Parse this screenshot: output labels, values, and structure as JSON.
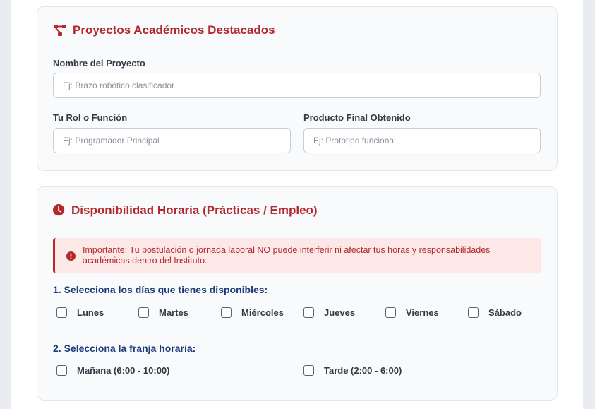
{
  "projects": {
    "title": "Proyectos Académicos Destacados",
    "icon": "project-diagram-icon",
    "name_label": "Nombre del Proyecto",
    "name_placeholder": "Ej: Brazo robótico clasificador",
    "role_label": "Tu Rol o Función",
    "role_placeholder": "Ej: Programador Principal",
    "product_label": "Producto Final Obtenido",
    "product_placeholder": "Ej: Prototipo funcional"
  },
  "availability": {
    "title": "Disponibilidad Horaria (Prácticas / Empleo)",
    "icon": "clock-icon",
    "alert_icon": "info-circle-icon",
    "alert_text": "Importante: Tu postulación o jornada laboral NO puede interferir ni afectar tus horas y responsabilidades académicas dentro del Instituto.",
    "days_question": "1. Selecciona los días que tienes disponibles:",
    "days": [
      "Lunes",
      "Martes",
      "Miércoles",
      "Jueves",
      "Viernes",
      "Sábado"
    ],
    "shift_question": "2. Selecciona la franja horaria:",
    "shifts": [
      "Mañana (6:00 - 10:00)",
      "Tarde (2:00 - 6:00)"
    ]
  },
  "colors": {
    "accent": "#b3282d",
    "heading_blue": "#1f3a7a",
    "alert_bg": "#fde8e8"
  }
}
